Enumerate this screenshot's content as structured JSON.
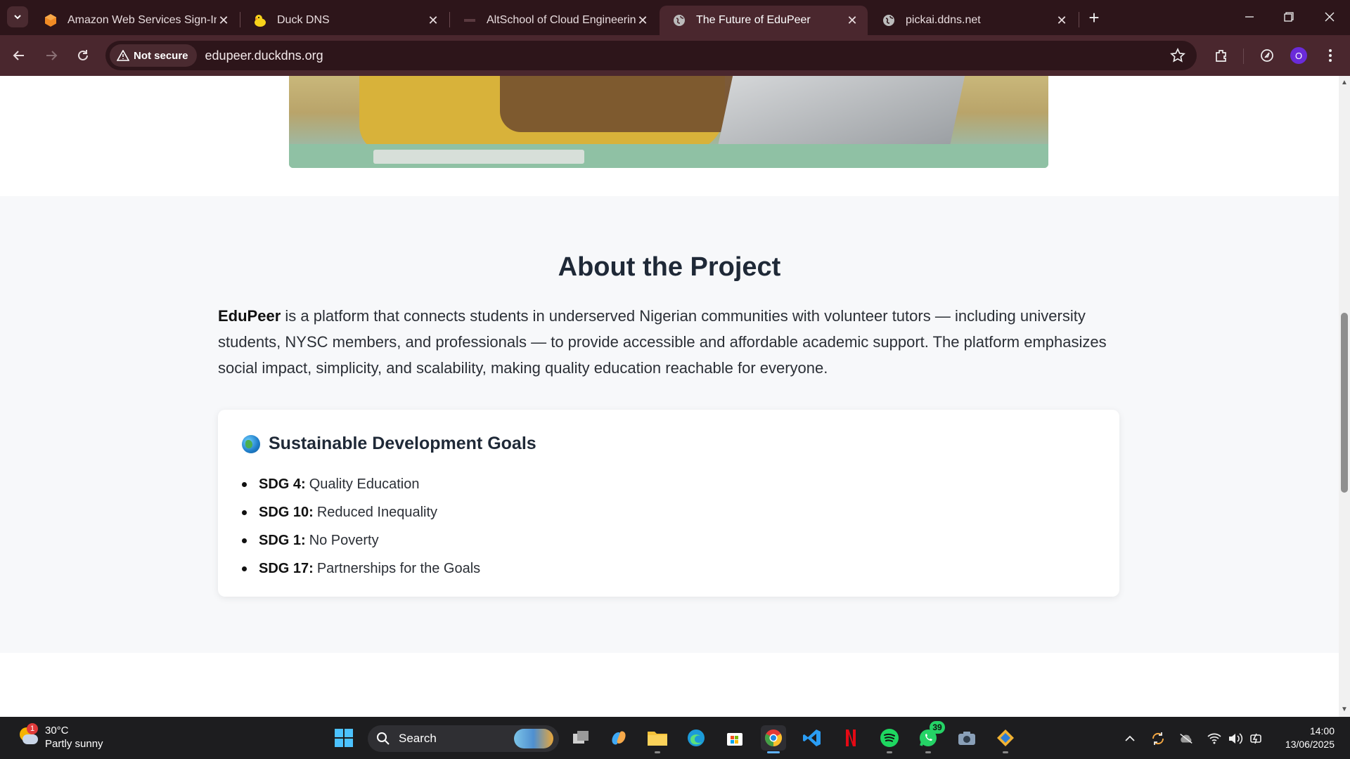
{
  "browser": {
    "tabs": [
      {
        "title": "Amazon Web Services Sign-In",
        "favicon": "aws-icon",
        "active": false
      },
      {
        "title": "Duck DNS",
        "favicon": "duck-icon",
        "active": false
      },
      {
        "title": "AltSchool of Cloud Engineering",
        "favicon": "altschool-icon",
        "active": false
      },
      {
        "title": "The Future of EduPeer",
        "favicon": "globe-icon",
        "active": true
      },
      {
        "title": "pickai.ddns.net",
        "favicon": "globe-icon",
        "active": false
      }
    ],
    "security_label": "Not secure",
    "url": "edupeer.duckdns.org",
    "profile_initial": "O"
  },
  "page": {
    "about": {
      "heading": "About the Project",
      "brand": "EduPeer",
      "description": " is a platform that connects students in underserved Nigerian communities with volunteer tutors — including university students, NYSC members, and professionals — to provide accessible and affordable academic support. The platform emphasizes social impact, simplicity, and scalability, making quality education reachable for everyone."
    },
    "sdg_card": {
      "heading": "Sustainable Development Goals",
      "items": [
        {
          "code": "SDG 4:",
          "text": "Quality Education"
        },
        {
          "code": "SDG 10:",
          "text": "Reduced Inequality"
        },
        {
          "code": "SDG 1:",
          "text": "No Poverty"
        },
        {
          "code": "SDG 17:",
          "text": "Partnerships for the Goals"
        }
      ]
    }
  },
  "taskbar": {
    "weather_temp": "30°C",
    "weather_desc": "Partly sunny",
    "weather_badge": "1",
    "search_label": "Search",
    "whatsapp_badge": "39",
    "time": "14:00",
    "date": "13/06/2025"
  }
}
